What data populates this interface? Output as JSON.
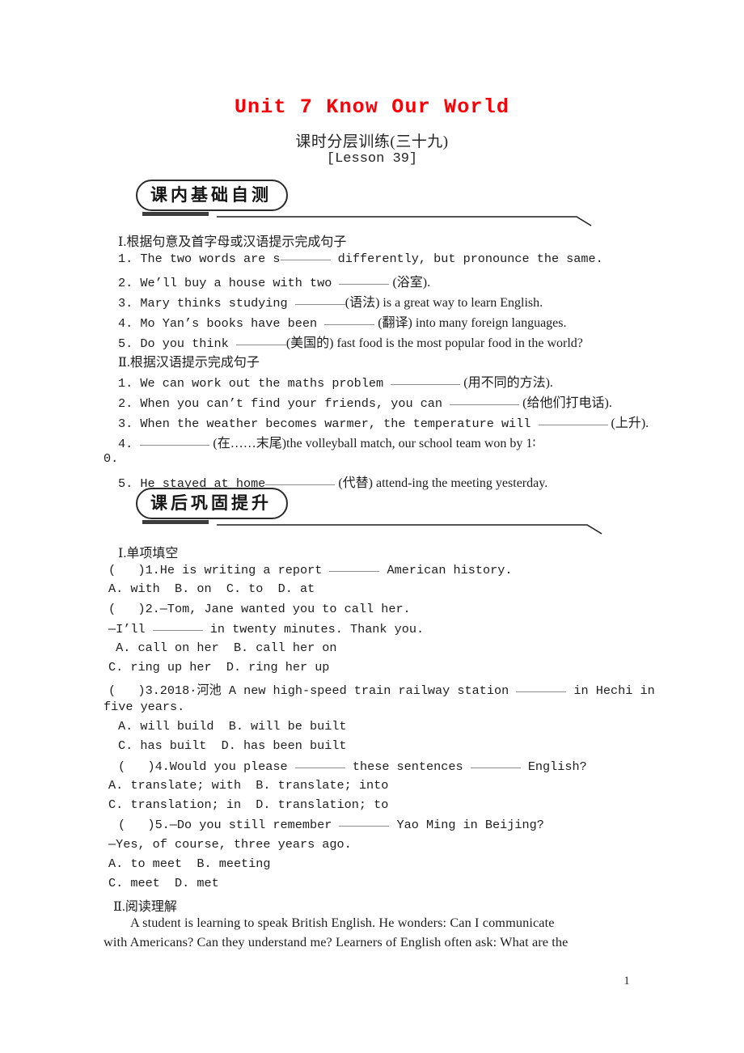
{
  "document": {
    "title": "Unit 7 Know Our World",
    "subtitle": "课时分层训练(三十九)",
    "lesson": "[Lesson 39]",
    "page_number": "1",
    "title_color": "#fb0007"
  },
  "sections": [
    {
      "badge": "课内基础自测",
      "parts": [
        {
          "heading": "Ⅰ.根据句意及首字母或汉语提示完成句子"
        }
      ]
    },
    {
      "badge": "课后巩固提升",
      "parts": [
        {
          "heading": "Ⅰ.单项填空"
        }
      ]
    }
  ],
  "section1": {
    "badge": "课内基础自测",
    "part1_heading": "Ⅰ.根据句意及首字母或汉语提示完成句子",
    "part1_items": [
      {
        "num": "1.",
        "a": "The two words are s",
        "b": " differently, but pronounce the same."
      },
      {
        "num": "2.",
        "a": "We’ll buy a house with two ",
        "b": " (浴室)."
      },
      {
        "num": "3.",
        "a": "Mary thinks studying ",
        "b": "(语法) is a great way to learn English."
      },
      {
        "num": "4.",
        "a": "Mo Yan’s books have been ",
        "b": " (翻译) into many foreign languages."
      },
      {
        "num": "5.",
        "a": "Do you think ",
        "b": "(美国的) fast food is the most popular food in the world?"
      }
    ],
    "part2_heading": "Ⅱ.根据汉语提示完成句子",
    "part2_items": [
      {
        "num": "1.",
        "a": "We can work out the maths problem ",
        "b": " (用不同的方法)."
      },
      {
        "num": "2.",
        "a": "When you can’t find your friends, you can ",
        "b": " (给他们打电话)."
      },
      {
        "num": "3.",
        "a": "When the weather becomes warmer, the temperature will ",
        "b": " (上升)."
      },
      {
        "num": "4.",
        "a": "",
        "b": " (在……末尾)the volleyball match, our school team won by 1∶",
        "wrap": "0."
      },
      {
        "num": "5.",
        "a": "He stayed at home",
        "b": " (代替) attend-ing the meeting yesterday."
      }
    ]
  },
  "section2": {
    "badge": "课后巩固提升",
    "part1_heading": "Ⅰ.单项填空",
    "questions": [
      {
        "stem_pre": "(   )1.He is writing a report ",
        "stem_post": " American history.",
        "options": "A. with  B. on  C. to  D. at"
      },
      {
        "stem_pre": "(   )2.—Tom, Jane wanted you to call her.",
        "stem_post": "",
        "line2_pre": "—I’ll ",
        "line2_post": " in twenty minutes. Thank you.",
        "options_a": " A. call on her  B. call her on",
        "options_b": "C. ring up her  D. ring her up"
      },
      {
        "stem_pre": "(   )3.2018·河池 A new high-speed train railway station ",
        "stem_post": " in Hechi in",
        "wrap": "five years.",
        "options_a": "A. will build  B. will be built",
        "options_b": "C. has built  D. has been built"
      },
      {
        "stem_pre": "(   )4.Would you please ",
        "stem_mid": " these sentences ",
        "stem_post": " English?",
        "options_a": "A. translate; with  B. translate; into",
        "options_b": "C. translation; in  D. translation; to"
      },
      {
        "stem_pre": "(   )5.—Do you still remember ",
        "stem_post": " Yao Ming in Beijing?",
        "line2": "—Yes, of course, three years ago.",
        "options_a": "A. to meet  B. meeting",
        "options_b": "C. meet  D. met"
      }
    ],
    "part2_heading": "Ⅱ.阅读理解",
    "passage_line1": "A student is learning to speak British English. He wonders: Can I communicate",
    "passage_line2": "with Americans? Can they understand me? Learners of English often ask: What are the"
  }
}
